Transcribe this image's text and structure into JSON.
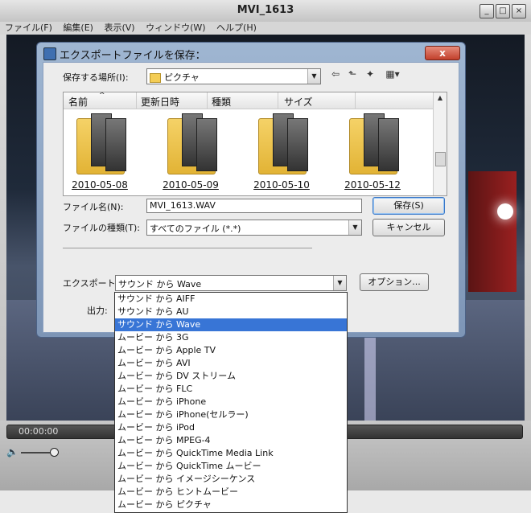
{
  "window": {
    "title": "MVI_1613"
  },
  "menu": [
    "ファイル(F)",
    "編集(E)",
    "表示(V)",
    "ウィンドウ(W)",
    "ヘルプ(H)"
  ],
  "player": {
    "time": "00:00:00"
  },
  "dialog": {
    "title": "エクスポートファイルを保存：",
    "location_label": "保存する場所(I):",
    "location_value": "ピクチャ",
    "columns": [
      "名前",
      "更新日時",
      "種類",
      "サイズ"
    ],
    "folders": [
      "2010-05-08",
      "2010-05-09",
      "2010-05-10",
      "2010-05-12"
    ],
    "filename_label": "ファイル名(N):",
    "filename_value": "MVI_1613.WAV",
    "filetype_label": "ファイルの種類(T):",
    "filetype_value": "すべてのファイル (*.*)",
    "save_button": "保存(S)",
    "cancel_button": "キャンセル",
    "export_label": "エクスポート:",
    "export_value": "サウンド から Wave",
    "options_button": "オプション...",
    "output_label": "出力:"
  },
  "export_options": [
    "サウンド から AIFF",
    "サウンド から AU",
    "サウンド から Wave",
    "ムービー から 3G",
    "ムービー から Apple TV",
    "ムービー から AVI",
    "ムービー から DV ストリーム",
    "ムービー から FLC",
    "ムービー から iPhone",
    "ムービー から iPhone(セルラー)",
    "ムービー から iPod",
    "ムービー から MPEG-4",
    "ムービー から QuickTime Media Link",
    "ムービー から QuickTime ムービー",
    "ムービー から イメージシーケンス",
    "ムービー から ヒントムービー",
    "ムービー から ピクチャ"
  ],
  "selected_export_index": 2,
  "colors": {
    "selection": "#3875d6",
    "dialog_frame": "#7d95b6",
    "close_button": "#c2402c"
  }
}
